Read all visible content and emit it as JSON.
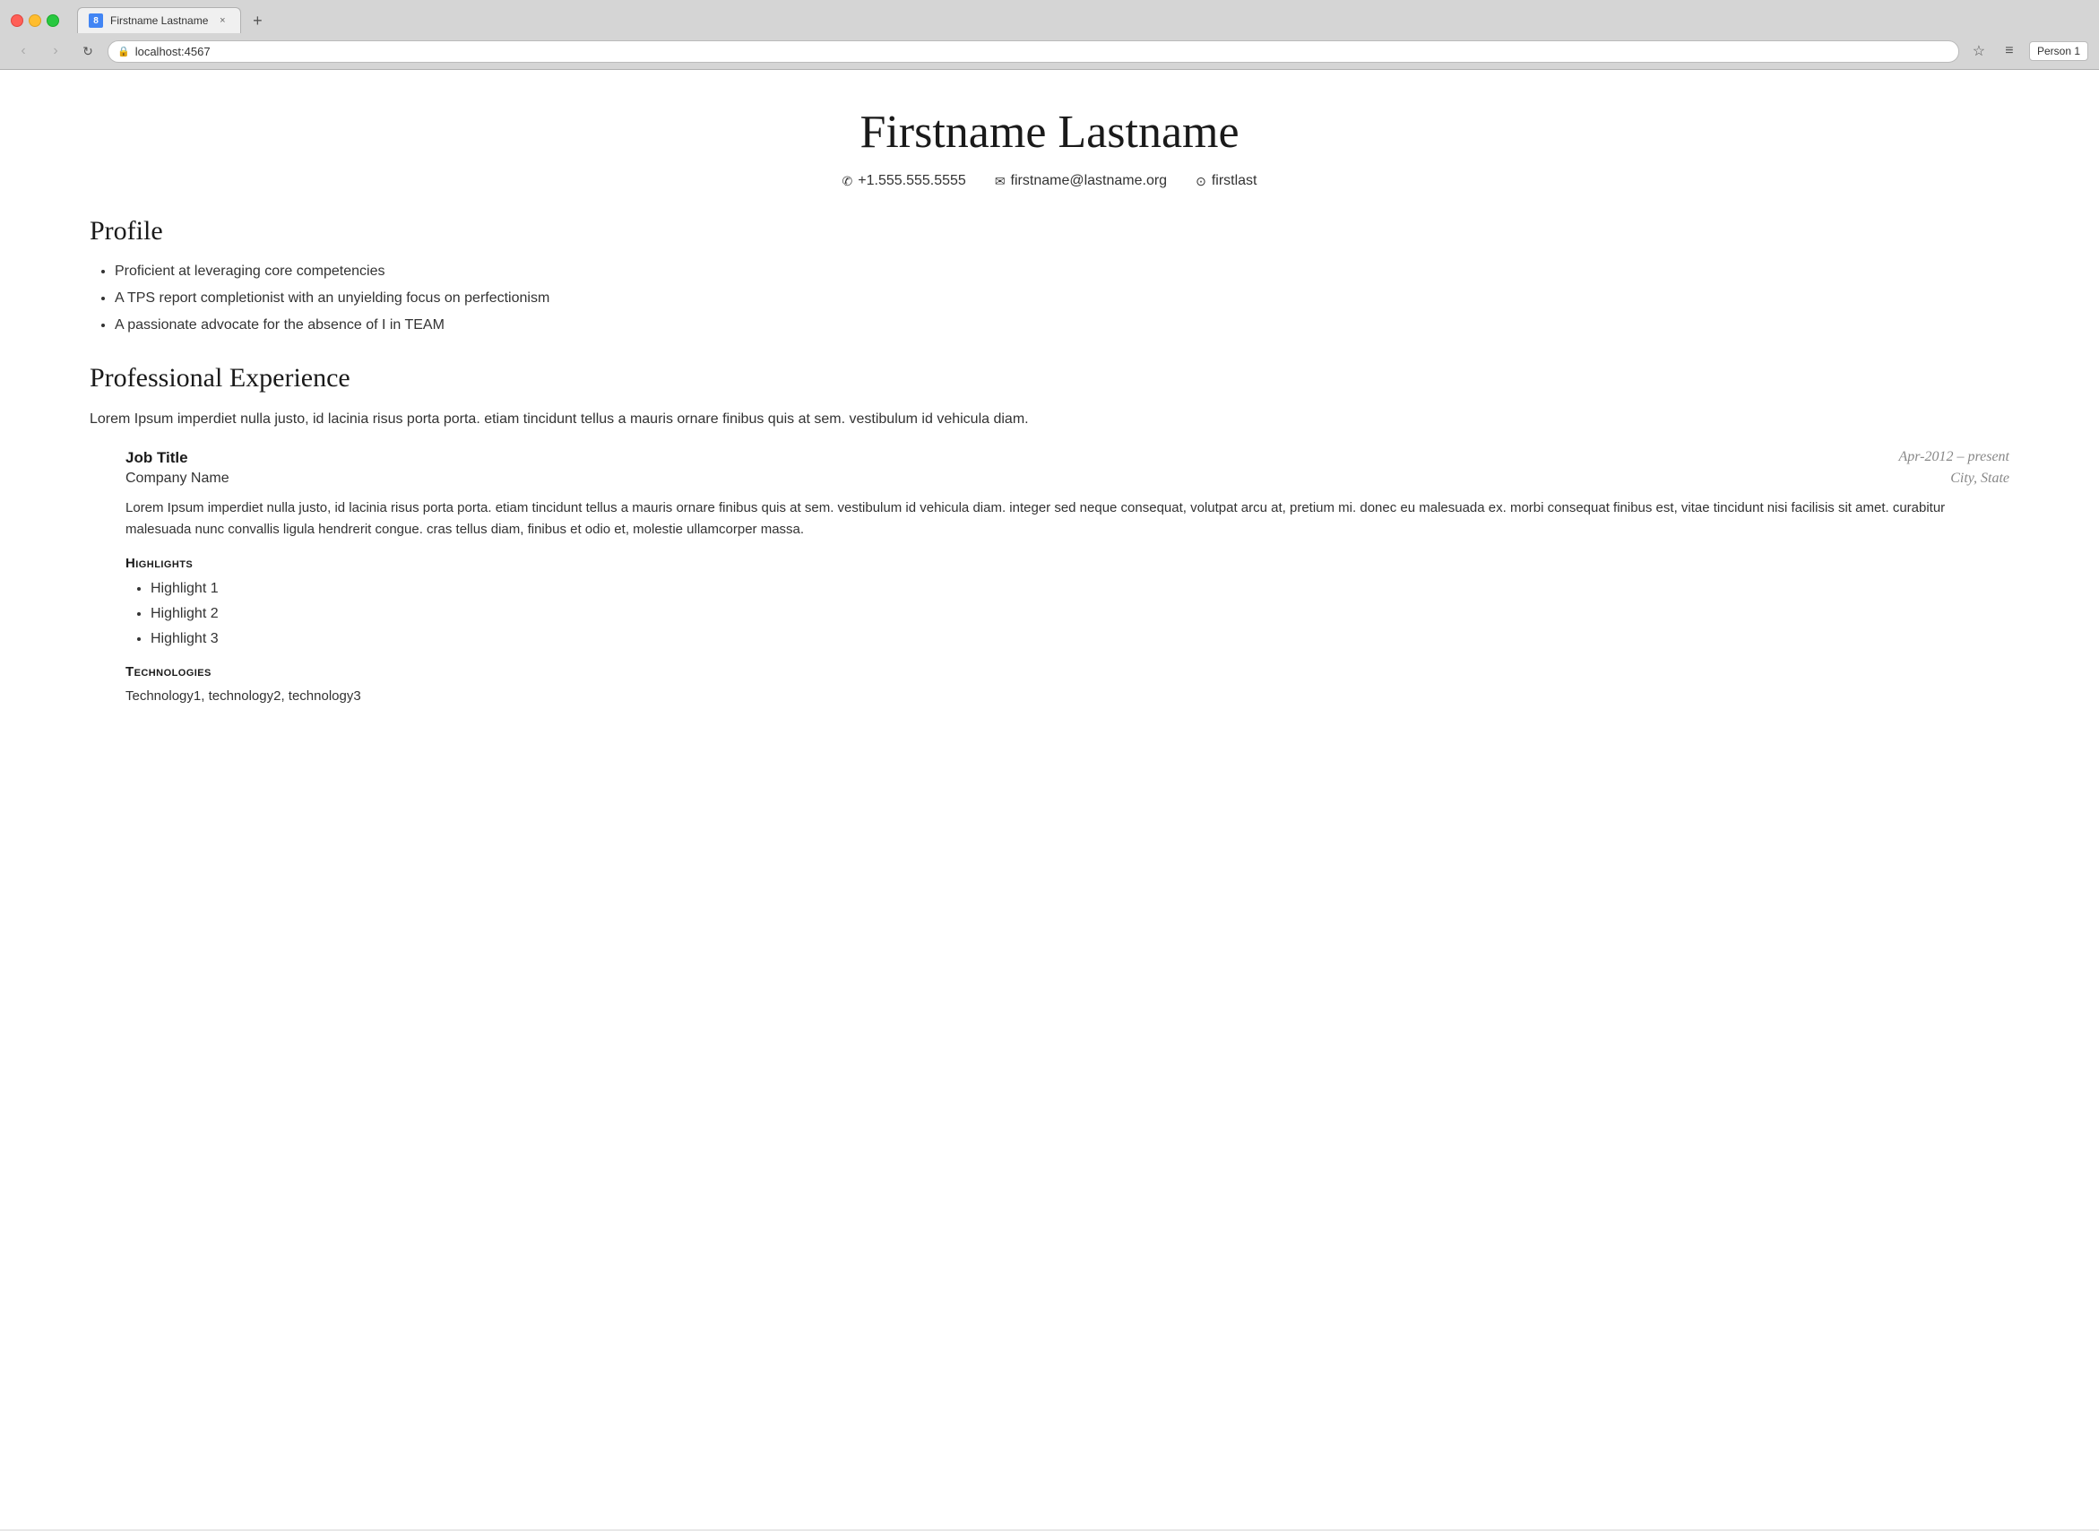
{
  "browser": {
    "tab": {
      "favicon_label": "8",
      "title": "Firstname Lastname",
      "close_label": "×"
    },
    "new_tab_label": "+",
    "nav": {
      "back_label": "‹",
      "forward_label": "›",
      "refresh_label": "↻"
    },
    "address": "localhost:4567",
    "star_label": "☆",
    "menu_label": "≡",
    "person_label": "Person 1"
  },
  "resume": {
    "name": "Firstname Lastname",
    "contact": {
      "phone_icon": "✆",
      "phone": "+1.555.555.5555",
      "email_icon": "✉",
      "email": "firstname@lastname.org",
      "github_icon": "⊙",
      "github": "firstlast"
    },
    "profile": {
      "section_title": "Profile",
      "bullets": [
        "Proficient at leveraging core competencies",
        "A TPS report completionist with an unyielding focus on perfectionism",
        "A passionate advocate for the absence of I in TEAM"
      ]
    },
    "experience": {
      "section_title": "Professional Experience",
      "intro": "Lorem Ipsum imperdiet nulla justo, id lacinia risus porta porta. etiam tincidunt tellus a mauris ornare finibus quis at sem. vestibulum id vehicula diam.",
      "jobs": [
        {
          "title": "Job Title",
          "dates": "Apr-2012 – present",
          "company": "Company Name",
          "location": "City, State",
          "description": "Lorem Ipsum imperdiet nulla justo, id lacinia risus porta porta. etiam tincidunt tellus a mauris ornare finibus quis at sem. vestibulum id vehicula diam. integer sed neque consequat, volutpat arcu at, pretium mi. donec eu malesuada ex. morbi consequat finibus est, vitae tincidunt nisi facilisis sit amet. curabitur malesuada nunc convallis ligula hendrerit congue. cras tellus diam, finibus et odio et, molestie ullamcorper massa.",
          "highlights_label": "Highlights",
          "highlights": [
            "Highlight 1",
            "Highlight 2",
            "Highlight 3"
          ],
          "technologies_label": "Technologies",
          "technologies": "Technology1, technology2, technology3"
        }
      ]
    }
  }
}
